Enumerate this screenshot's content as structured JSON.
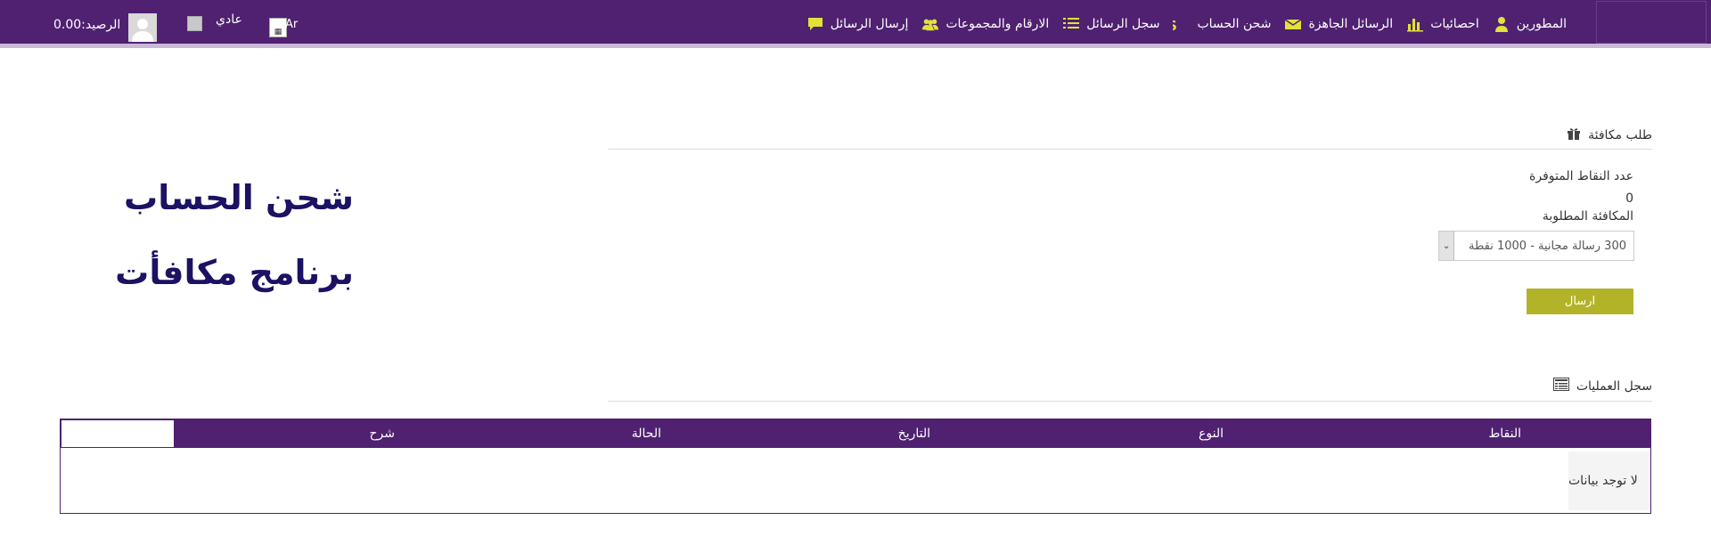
{
  "nav": {
    "items": [
      {
        "label": "إرسال الرسائل",
        "icon": "chat-bubble-icon"
      },
      {
        "label": "الارقام والمجموعات",
        "icon": "users-group-icon"
      },
      {
        "label": "سجل الرسائل",
        "icon": "list-icon"
      },
      {
        "label": "شحن الحساب",
        "icon": "dollar-icon"
      },
      {
        "label": "الرسائل الجاهزة",
        "icon": "envelope-icon"
      },
      {
        "label": "احصائيات",
        "icon": "bar-chart-icon"
      },
      {
        "label": "المطورين",
        "icon": "user-icon"
      }
    ]
  },
  "user": {
    "balance": "الرصيد:0.00",
    "mode": "عادي",
    "lang": "Ar"
  },
  "page": {
    "title": "شحن الحساب",
    "subtitle": "برنامج مكافأت"
  },
  "reward": {
    "heading": "طلب مكافئة",
    "points_label": "عدد النقاط المتوفرة",
    "points_value": "0",
    "reward_label": "المكافئة المطلوبة",
    "reward_selected": "300 رسالة مجانية - 1000 نقطة",
    "send_label": "ارسال"
  },
  "operations": {
    "heading": "سجل العمليات",
    "columns": [
      "النقاط",
      "النوع",
      "التاريخ",
      "الحالة",
      "شرح"
    ],
    "empty_text": "لا توجد بيانات"
  },
  "colors": {
    "brand": "#4f2170",
    "accent": "#b3b32a",
    "title": "#1b1263",
    "nav_icon": "#e1e23a"
  }
}
